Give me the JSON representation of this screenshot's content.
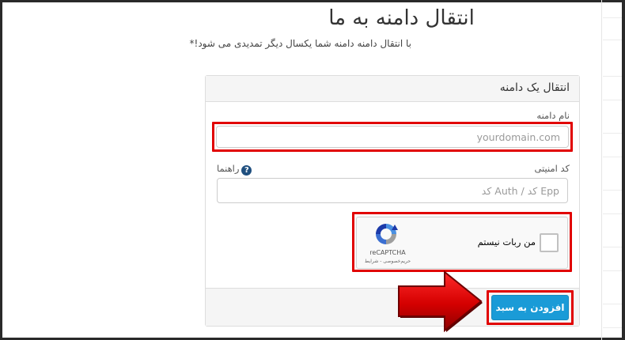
{
  "page": {
    "title": "انتقال دامنه به ما",
    "subtitle": "با انتقال دامنه دامنه شما یکسال دیگر تمدیدی می شود!*"
  },
  "card": {
    "header": "انتقال یک دامنه",
    "domain_label": "نام دامنه",
    "domain_placeholder": "yourdomain.com",
    "auth_label": "کد امنیتی",
    "help_label": "راهنما",
    "auth_placeholder": "Epp کد / Auth کد",
    "captcha": {
      "label": "من ربات نیستم",
      "brand": "reCAPTCHA",
      "sub": "حریم‌خصوصی - شرایط"
    },
    "submit_label": "افزودن به سبد"
  },
  "colors": {
    "highlight": "#e10000",
    "button": "#1a9bd7",
    "arrow": "#d40000"
  },
  "icons": {
    "help": "question-circle-icon",
    "recaptcha": "recaptcha-logo-icon",
    "arrow": "red-arrow-pointer-icon"
  }
}
